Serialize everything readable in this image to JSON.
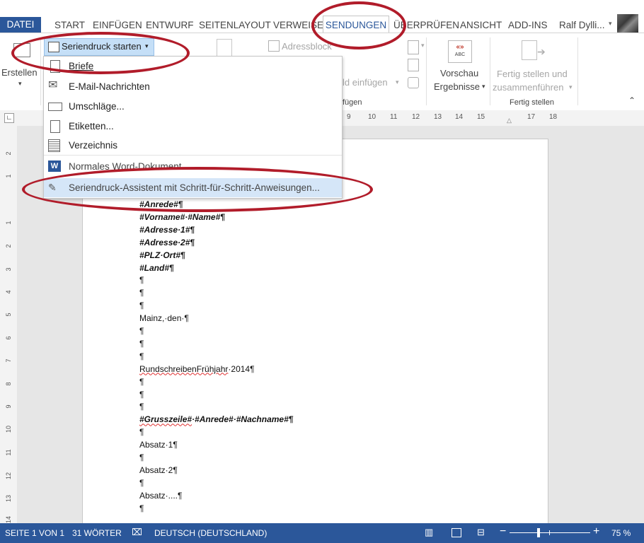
{
  "tabs": {
    "datei": "DATEI",
    "start": "START",
    "einfuegen": "EINFÜGEN",
    "entwurf": "ENTWURF",
    "seitenlayout": "SEITENLAYOUT",
    "verweise": "VERWEISE",
    "sendungen": "SENDUNGEN",
    "ueberpruefen": "ÜBERPRÜFEN",
    "ansicht": "ANSICHT",
    "addins": "ADD-INS",
    "user": "Ralf Dylli..."
  },
  "ribbon": {
    "erstellen": "Erstellen",
    "seriendruck_starten": "Seriendruck starten",
    "adressblock": "Adressblock",
    "feld_einfuegen": "ld einfügen",
    "group_einfuegen": "fügen",
    "vorschau": "Vorschau",
    "ergebnisse": "Ergebnisse",
    "fertig_line1": "Fertig stellen und",
    "fertig_line2": "zusammenführen",
    "group_fertig": "Fertig stellen",
    "abc": "ABC"
  },
  "menu": {
    "items": [
      {
        "label": "Briefe"
      },
      {
        "label": "E-Mail-Nachrichten"
      },
      {
        "label": "Umschläge..."
      },
      {
        "label": "Etiketten..."
      },
      {
        "label": "Verzeichnis"
      },
      {
        "label": "Normales Word-Dokument"
      },
      {
        "label": "Seriendruck-Assistent mit Schritt-für-Schritt-Anweisungen..."
      }
    ]
  },
  "ruler": {
    "ticks": [
      "9",
      "10",
      "11",
      "12",
      "13",
      "14",
      "15",
      "17",
      "18"
    ],
    "vticks": [
      "2",
      "1",
      "1",
      "2",
      "3",
      "4",
      "5",
      "6",
      "7",
      "8",
      "9",
      "10",
      "11",
      "12",
      "13",
      "14"
    ]
  },
  "document": {
    "lines": [
      "#Anrede#¶",
      "#Vorname#·#Name#¶",
      "#Adresse·1#¶",
      "#Adresse·2#¶",
      "#PLZ·Ort#¶",
      "#Land#¶",
      "¶",
      "¶",
      "¶",
      "Mainz,·den·¶",
      "¶",
      "¶",
      "¶",
      "RundschreibenFrühjahr·2014¶",
      "¶",
      "¶",
      "¶",
      "#Grusszeile#·#Anrede#·#Nachname#¶",
      "¶",
      "Absatz·1¶",
      "¶",
      "Absatz·2¶",
      "¶",
      "Absatz·....¶",
      "¶"
    ]
  },
  "status": {
    "page": "SEITE 1 VON 1",
    "words": "31 WÖRTER",
    "language": "DEUTSCH (DEUTSCHLAND)",
    "zoom": "75 %",
    "zoom_level": 0.75
  },
  "colors": {
    "accent": "#2b579a",
    "highlight_ring": "#b11c2a"
  }
}
